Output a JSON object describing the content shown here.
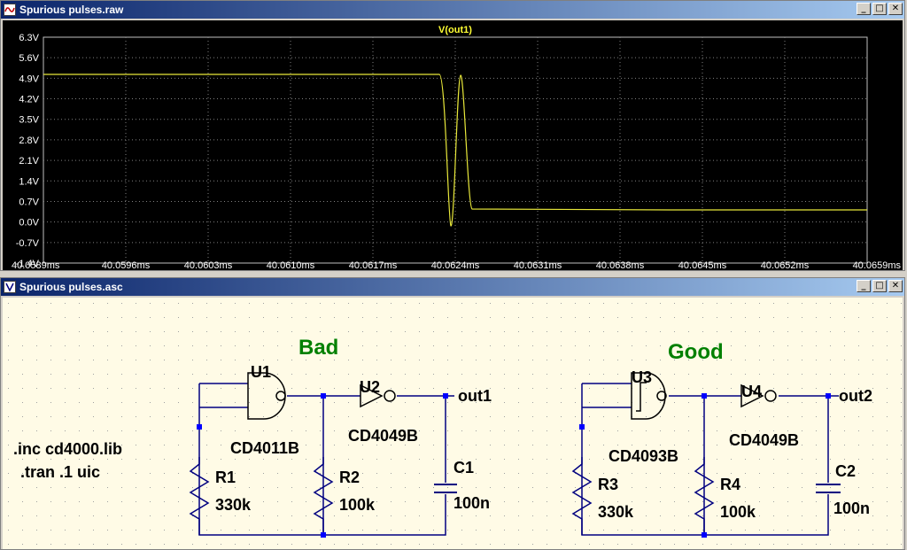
{
  "waveform_window": {
    "title": "Spurious pulses.raw",
    "trace_label": "V(out1)",
    "trace_color": "#ffff33",
    "y_ticks": [
      "6.3V",
      "5.6V",
      "4.9V",
      "4.2V",
      "3.5V",
      "2.8V",
      "2.1V",
      "1.4V",
      "0.7V",
      "0.0V",
      "-0.7V",
      "-1.4V"
    ],
    "x_ticks": [
      "40.0589ms",
      "40.0596ms",
      "40.0603ms",
      "40.0610ms",
      "40.0617ms",
      "40.0624ms",
      "40.0631ms",
      "40.0638ms",
      "40.0645ms",
      "40.0652ms",
      "40.0659ms"
    ]
  },
  "schematic_window": {
    "title": "Spurious pulses.asc",
    "heading_bad": "Bad",
    "heading_good": "Good",
    "directive_inc": ".inc cd4000.lib",
    "directive_tran": ".tran .1 uic",
    "bad": {
      "u1_ref": "U1",
      "u1_model": "CD4011B",
      "u2_ref": "U2",
      "u2_model": "CD4049B",
      "r1_ref": "R1",
      "r1_value": "330k",
      "r2_ref": "R2",
      "r2_value": "100k",
      "c1_ref": "C1",
      "c1_value": "100n",
      "net": "out1"
    },
    "good": {
      "u3_ref": "U3",
      "u3_model": "CD4093B",
      "u4_ref": "U4",
      "u4_model": "CD4049B",
      "r3_ref": "R3",
      "r3_value": "330k",
      "r4_ref": "R4",
      "r4_value": "100k",
      "c2_ref": "C2",
      "c2_value": "100n",
      "net": "out2"
    }
  },
  "window_controls": {
    "minimize": "_",
    "maximize": "□",
    "close": "✕"
  },
  "colors": {
    "wire": "#000080",
    "label": "#000000",
    "heading": "#008000",
    "junction": "#0000ff"
  }
}
